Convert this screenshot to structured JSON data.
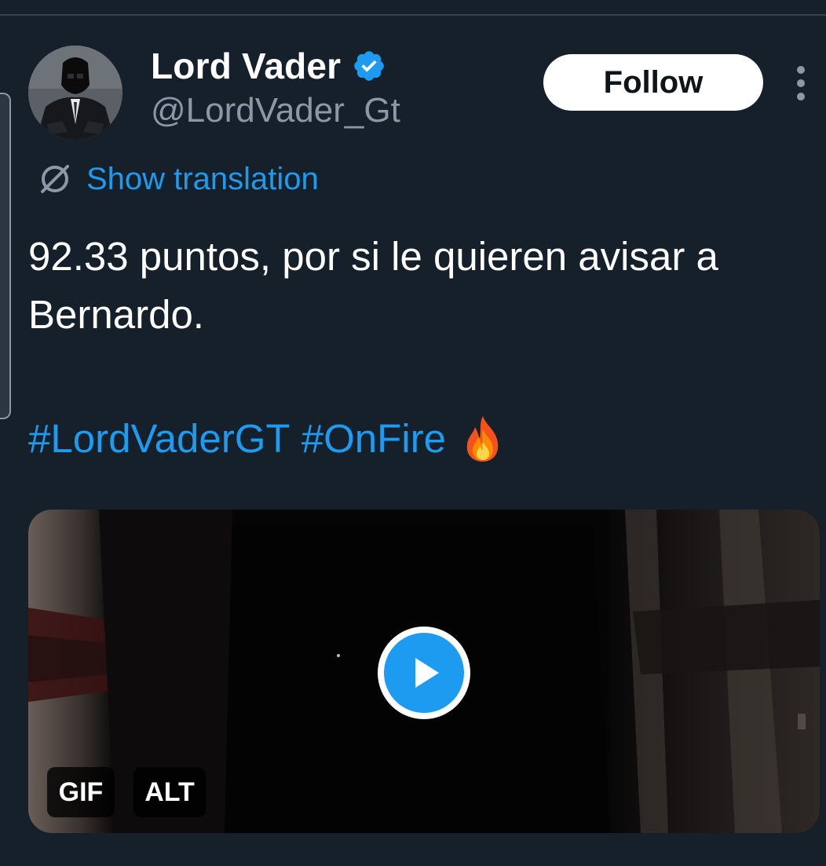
{
  "author": {
    "display_name": "Lord Vader",
    "handle": "@LordVader_Gt",
    "verified": true,
    "avatar_icon": "darth-vader-avatar"
  },
  "actions": {
    "follow_label": "Follow",
    "more_icon": "more-vertical-icon"
  },
  "translation": {
    "icon": "globe-icon",
    "label": "Show translation"
  },
  "tweet": {
    "text": "92.33 puntos, por si le quieren avisar a Bernardo.",
    "hashtags": [
      "#LordVaderGT",
      "#OnFire"
    ],
    "emoji": "fire-emoji"
  },
  "media": {
    "type": "GIF",
    "gif_badge": "GIF",
    "alt_badge": "ALT",
    "play_icon": "play-icon"
  },
  "colors": {
    "background": "#15202b",
    "accent": "#1d9bf0",
    "secondary_text": "#8b98a5",
    "primary_text": "#ffffff"
  }
}
